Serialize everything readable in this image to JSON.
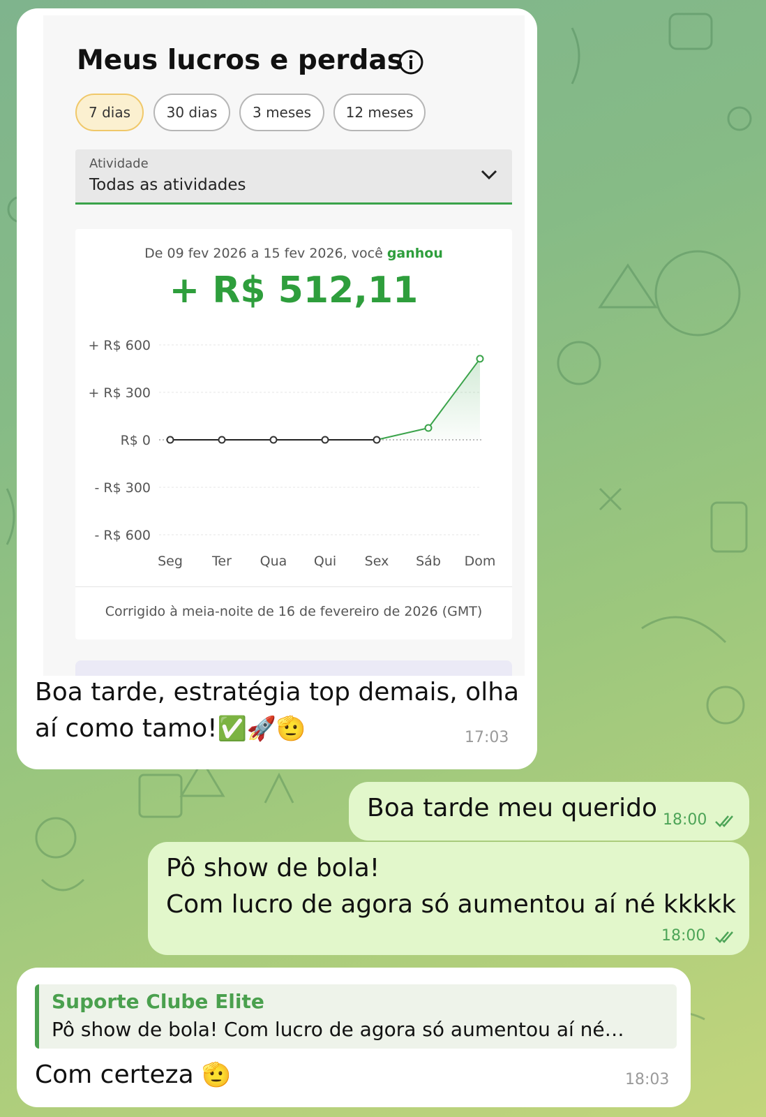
{
  "shot": {
    "title": "Meus lucros e perdas",
    "filters": [
      "7 dias",
      "30 dias",
      "3 meses",
      "12 meses"
    ],
    "active_filter": "7 dias",
    "activity": {
      "label": "Atividade",
      "value": "Todas as atividades"
    },
    "period_prefix": "De 09 fev 2026 a 15 fev 2026, você",
    "period_keyword": "ganhou",
    "total": "+ R$ 512,11",
    "footnote": "Corrigido à meia-noite de 16 de fevereiro de 2026 (GMT)"
  },
  "chart_data": {
    "type": "line",
    "categories": [
      "Seg",
      "Ter",
      "Qua",
      "Qui",
      "Sex",
      "Sáb",
      "Dom"
    ],
    "values": [
      0,
      0,
      0,
      0,
      0,
      75,
      512.11
    ],
    "yticks": [
      "+ R$ 600",
      "+ R$ 300",
      "R$ 0",
      "- R$ 300",
      "- R$ 600"
    ],
    "ylim": [
      -600,
      600
    ],
    "colors": {
      "positive": "#3aa34a",
      "neutral": "#222222"
    }
  },
  "messages": {
    "m1": {
      "text": "Boa tarde, estratégia top demais, olha aí como tamo!",
      "emojis": "✅🚀🫡",
      "time": "17:03"
    },
    "m2": {
      "text": "Boa tarde meu querido",
      "time": "18:00"
    },
    "m3": {
      "line1": "Pô show de bola!",
      "line2": "Com lucro de agora só aumentou aí né kkkkk",
      "time": "18:00"
    },
    "m4": {
      "reply_name": "Suporte Clube Elite",
      "reply_quote": "Pô show de bola! Com lucro de agora só aumentou aí né…",
      "text": "Com certeza",
      "emoji": "🫡",
      "time": "18:03"
    }
  }
}
